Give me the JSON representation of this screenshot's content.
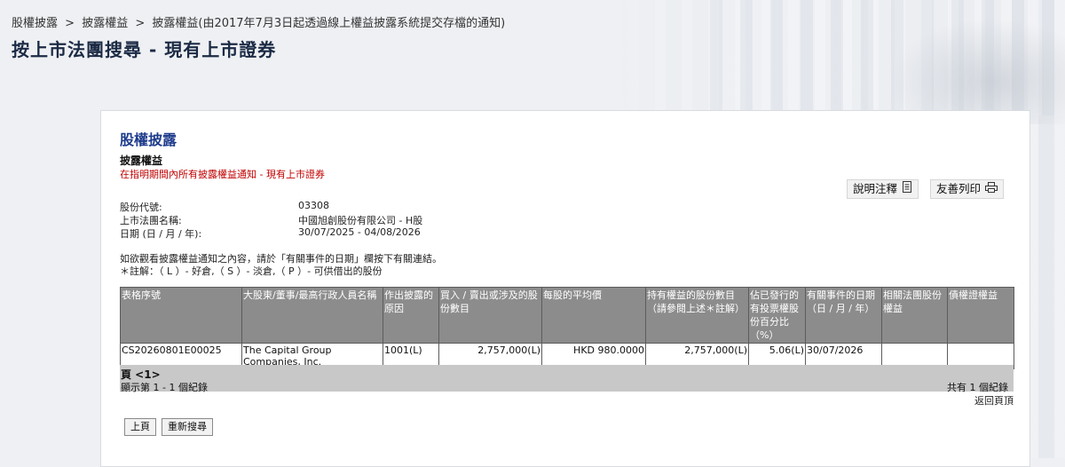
{
  "breadcrumb": {
    "items": [
      "股權披露",
      "披露權益",
      "披露權益(由2017年7月3日起透過線上權益披露系統提交存檔的通知)"
    ],
    "separator": ">"
  },
  "page_title": "按上市法團搜尋 - 現有上市證券",
  "panel": {
    "section_title": "股權披露",
    "sub_title": "披露權益",
    "sub_note": "在指明期間內所有披露權益通知 - 現有上市證券",
    "buttons": {
      "notes_label": "說明注釋",
      "notes_icon": "document-icon",
      "print_label": "友善列印",
      "print_icon": "printer-icon"
    },
    "info": {
      "stock_code_label": "股份代號:",
      "stock_code_value": "03308",
      "company_label": "上市法團名稱:",
      "company_value": "中國旭創股份有限公司 - H股",
      "date_label": "日期 (日 / 月 / 年):",
      "date_value": "30/07/2025 - 04/08/2026"
    },
    "instruction_line1": "如欲觀看披露權益通知之內容，請於「有關事件的日期」欄按下有關連結。",
    "instruction_line2": "＊註解：（ L ）- 好倉,（ S ）- 淡倉,（ P ）- 可供借出的股份",
    "table": {
      "headers": [
        "表格序號",
        "大股東/董事/最高行政人員名稱",
        "作出披露的原因",
        "買入 / 賣出或涉及的股份數目",
        "每股的平均價",
        "持有權益的股份數目（請參閱上述＊註解）",
        "佔已發行的有投票權股份百分比（%）",
        "有關事件的日期（日 / 月 / 年）",
        "相關法團股份權益",
        "債權證權益"
      ],
      "rows": [
        {
          "form_no": "CS20260801E00025",
          "name": "The Capital Group Companies, Inc.",
          "reason": "1001(L)",
          "shares": "2,757,000(L)",
          "avg_price": "HKD 980.0000",
          "held": "2,757,000(L)",
          "percent": "5.06(L)",
          "event_date": "30/07/2026",
          "assoc": "",
          "debenture": ""
        }
      ]
    },
    "pager": {
      "page": "頁 <1>",
      "showing": "顯示第 1 - 1 個紀錄",
      "total": "共有 1 個紀錄"
    },
    "back_to_top": "返回頁頂",
    "prev_button": "上頁",
    "new_search_button": "重新搜尋"
  },
  "colors": {
    "title_blue": "#1f3c8c",
    "note_red": "#c00000",
    "header_gray": "#8c8c8c",
    "pager_gray": "#c8c8c8"
  }
}
